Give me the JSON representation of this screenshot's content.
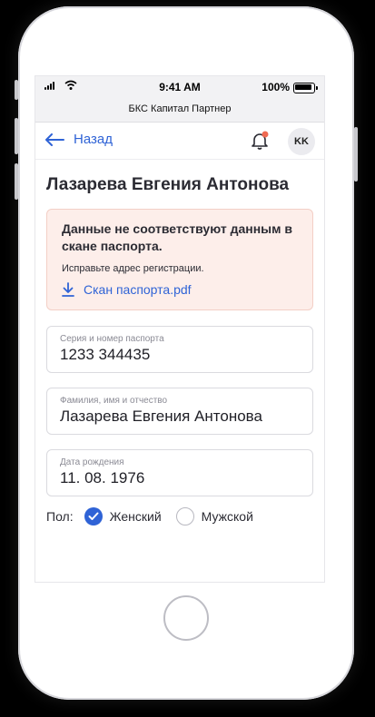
{
  "status_bar": {
    "time": "9:41 AM",
    "battery": "100%"
  },
  "app": {
    "name": "БКС Капитал Партнер"
  },
  "header": {
    "back_label": "Назад",
    "avatar_initials": "KK",
    "notification_dot_color": "#f06a52"
  },
  "client": {
    "name": "Лазарева Евгения Антонова"
  },
  "alert": {
    "title": "Данные не соответствуют данным в скане паспорта.",
    "message": "Исправьте адрес регистрации.",
    "file_name": "Скан паспорта.pdf"
  },
  "fields": {
    "passport": {
      "label": "Серия и номер паспорта",
      "value": "1233 344435"
    },
    "full_name": {
      "label": "Фамилия, имя и отчество",
      "value": "Лазарева Евгения Антонова"
    },
    "birth_date": {
      "label": "Дата рождения",
      "value": "11. 08. 1976"
    }
  },
  "gender": {
    "label": "Пол:",
    "options": [
      {
        "label": "Женский",
        "selected": true
      },
      {
        "label": "Мужской",
        "selected": false
      }
    ]
  },
  "colors": {
    "accent": "#2f63d6",
    "alert_bg": "#fdeeea",
    "alert_border": "#f3cfc6"
  }
}
